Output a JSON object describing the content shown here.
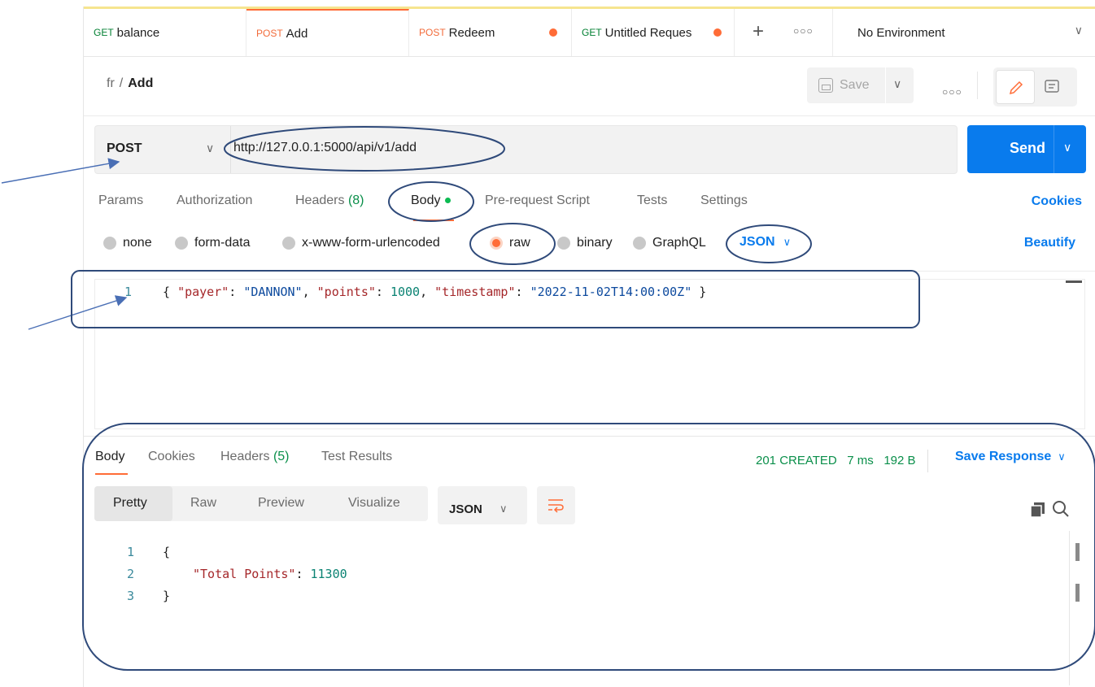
{
  "tabs": [
    {
      "method": "GET",
      "name": "balance"
    },
    {
      "method": "POST",
      "name": "Add"
    },
    {
      "method": "POST",
      "name": "Redeem"
    },
    {
      "method": "GET",
      "name": "Untitled Reques"
    }
  ],
  "environment": "No Environment",
  "breadcrumb": {
    "collection": "fr",
    "separator": "/",
    "request": "Add"
  },
  "save_label": "Save",
  "request": {
    "method": "POST",
    "url": "http://127.0.0.1:5000/api/v1/add",
    "send_label": "Send"
  },
  "request_tabs": {
    "params": "Params",
    "authorization": "Authorization",
    "headers": "Headers",
    "headers_count": "(8)",
    "body": "Body",
    "pre_request": "Pre-request Script",
    "tests": "Tests",
    "settings": "Settings",
    "cookies": "Cookies"
  },
  "body_types": {
    "none": "none",
    "form_data": "form-data",
    "urlencoded": "x-www-form-urlencoded",
    "raw": "raw",
    "binary": "binary",
    "graphql": "GraphQL",
    "format": "JSON",
    "beautify": "Beautify"
  },
  "editor": {
    "line": "1",
    "open": "{",
    "k1": "\"payer\"",
    "v1": "\"DANNON\"",
    "k2": "\"points\"",
    "v2": "1000",
    "k3": "\"timestamp\"",
    "v3": "\"2022-11-02T14:00:00Z\"",
    "close": "}"
  },
  "response_tabs": {
    "body": "Body",
    "cookies": "Cookies",
    "headers": "Headers",
    "headers_count": "(5)",
    "test_results": "Test Results"
  },
  "response_meta": {
    "status": "201 CREATED",
    "time": "7 ms",
    "size": "192 B",
    "save_response": "Save Response"
  },
  "response_formats": {
    "pretty": "Pretty",
    "raw": "Raw",
    "preview": "Preview",
    "visualize": "Visualize",
    "format": "JSON"
  },
  "response_body": {
    "l1": "1",
    "l2": "2",
    "l3": "3",
    "open": "{",
    "key": "\"Total Points\"",
    "colon": ":",
    "value": "11300",
    "close": "}"
  },
  "colors": {
    "accent": "#ff6c37",
    "send": "#097bed",
    "annotation": "#2f4a7a"
  },
  "icons": [
    "plus-icon",
    "more-icon",
    "save-icon",
    "edit-icon",
    "document-icon",
    "wrap-icon",
    "copy-icon",
    "search-icon",
    "chevron-down-icon"
  ]
}
